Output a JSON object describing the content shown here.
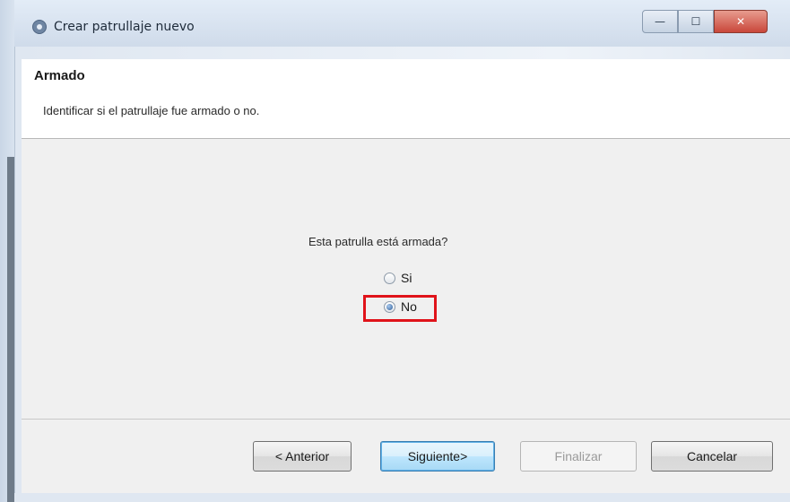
{
  "window": {
    "title": "Crear patrullaje nuevo",
    "controls": {
      "minimize": "—",
      "maximize": "☐",
      "close": "✕"
    }
  },
  "header": {
    "title": "Armado",
    "description": "Identificar si el patrullaje fue armado o no."
  },
  "main": {
    "question": "Esta patrulla está armada?",
    "options": [
      {
        "label": "Si",
        "selected": false
      },
      {
        "label": "No",
        "selected": true
      }
    ]
  },
  "footer": {
    "back_label": "< Anterior",
    "next_label": "Siguiente>",
    "finish_label": "Finalizar",
    "cancel_label": "Cancelar"
  },
  "colors": {
    "highlight": "#e0131a",
    "default_button_border": "#3c7fb1"
  }
}
